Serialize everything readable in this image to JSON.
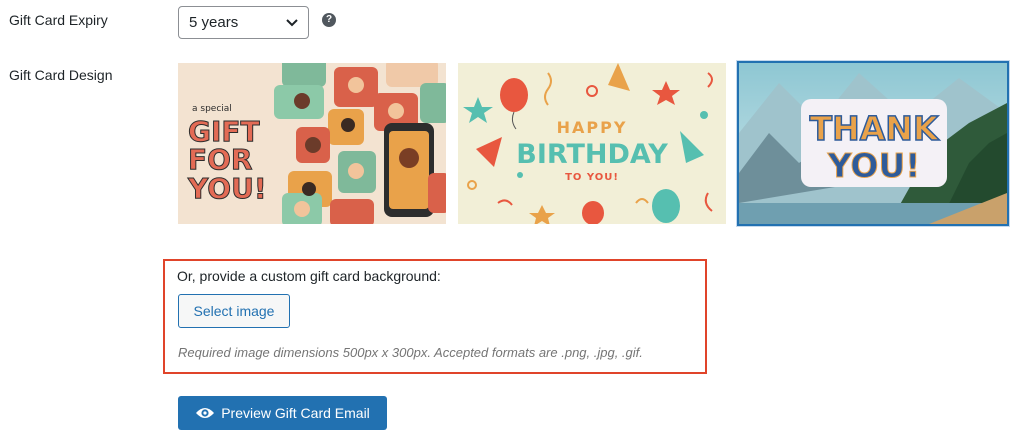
{
  "expiry": {
    "label": "Gift Card Expiry",
    "selected_value": "5 years",
    "help_icon": "question-circle-icon"
  },
  "design": {
    "label": "Gift Card Design",
    "options": [
      {
        "lines": [
          "a special",
          "GIFT",
          "FOR",
          "YOU!"
        ]
      },
      {
        "lines": [
          "HAPPY",
          "BIRTHDAY",
          "TO YOU!"
        ]
      },
      {
        "lines": [
          "THANK",
          "YOU!"
        ],
        "selected": true
      }
    ]
  },
  "custom_background": {
    "prompt": "Or, provide a custom gift card background:",
    "button_label": "Select image",
    "hint": "Required image dimensions 500px x 300px. Accepted formats are .png, .jpg, .gif."
  },
  "preview_button": {
    "label": "Preview Gift Card Email",
    "icon": "eye-icon"
  },
  "colors": {
    "accent": "#2271b1",
    "highlight_border": "#e0442a"
  }
}
